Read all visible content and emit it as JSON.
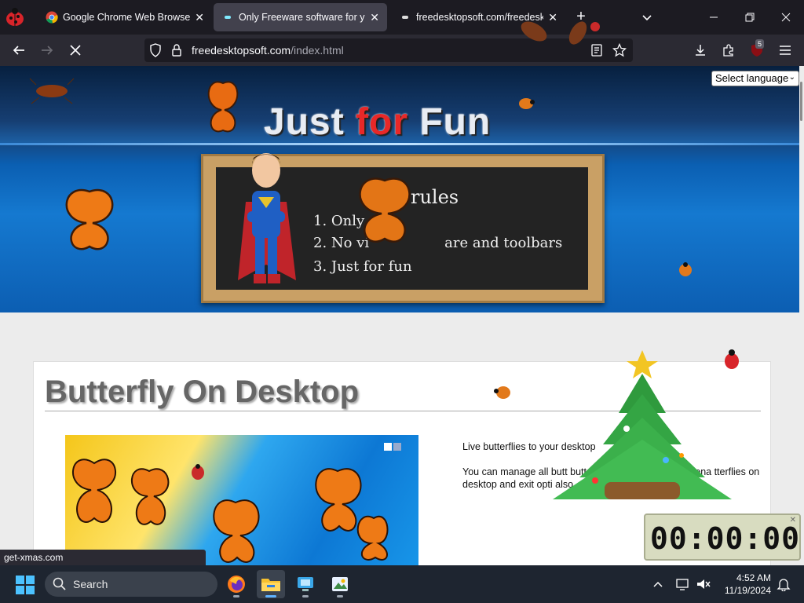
{
  "browser": {
    "tabs": [
      {
        "label": "Google Chrome Web Browser",
        "icon": "chrome-icon",
        "active": false
      },
      {
        "label": "Only Freeware software for you",
        "icon": "page-icon",
        "active": true
      },
      {
        "label": "freedesktopsoft.com/freedesk",
        "icon": "page-icon",
        "active": false
      }
    ],
    "url": {
      "domain": "freedesktopsoft.com",
      "path": "/index.html"
    },
    "extension_badge": "5"
  },
  "page": {
    "language_select": "Select language",
    "site_title": {
      "part1": "Just ",
      "accent": "for",
      "part2": " Fun"
    },
    "board": {
      "title": "rules",
      "rules": [
        "1. Only",
        "2. No vi",
        "3. Just for fun"
      ],
      "rule_suffix_2": "are and toolbars"
    },
    "product_title": "Butterfly On Desktop",
    "description": [
      "Live butterflies to your desktop",
      "You can manage all butt                       butterfly icon where you can ena                  tterflies on desktop and exit opti        also."
    ]
  },
  "status_bar_link": "get-xmas.com",
  "desktop_clock": {
    "time": "00:00:00"
  },
  "taskbar": {
    "search_label": "Search",
    "apps": [
      "firefox-icon",
      "file-explorer-icon",
      "desktop-app-icon",
      "photos-app-icon"
    ],
    "time": "4:52 AM",
    "date": "11/19/2024"
  },
  "colors": {
    "accent_red": "#e82828",
    "tab_active": "#42414d",
    "page_bg": "#ececec"
  }
}
